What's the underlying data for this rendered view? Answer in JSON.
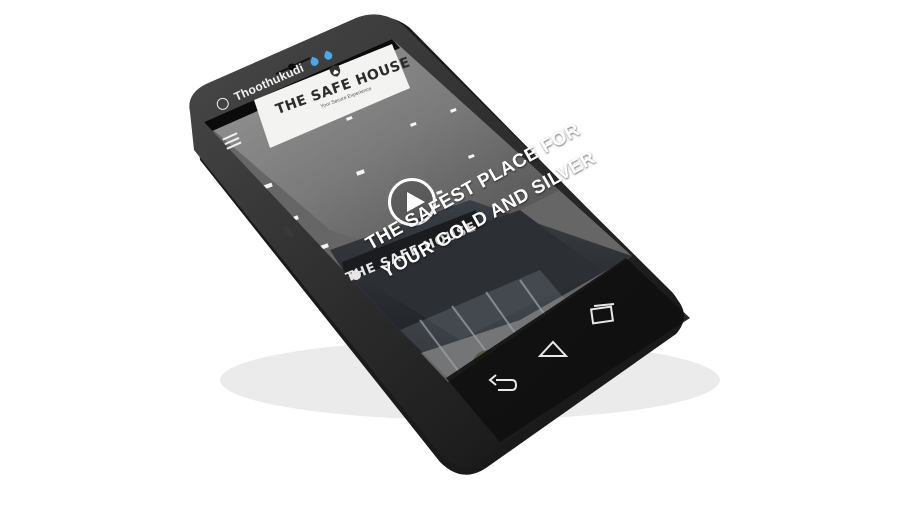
{
  "status_bar": {
    "carrier": "Thoothukudi",
    "icons": [
      "whatsapp-icon",
      "drop-icon",
      "drop-icon"
    ]
  },
  "header": {
    "menu_icon": "hamburger-menu-icon",
    "logo": {
      "title": "THE SAFE HOUSE",
      "tagline": "Your Secure Experience"
    }
  },
  "hero": {
    "signage": "THE SAFE HOUSE",
    "headline_line1": "THE SAFEST PLACE FOR",
    "headline_line2": "YOUR GOLD AND SILVER",
    "play_icon": "play-icon"
  },
  "nav_bar": {
    "back_icon": "back-icon",
    "home_icon": "home-icon",
    "recents_icon": "recents-icon"
  },
  "colors": {
    "phone_body": "#2a2a2a",
    "screen_bg": "#6f6f6f",
    "headline": "#ffffff"
  }
}
